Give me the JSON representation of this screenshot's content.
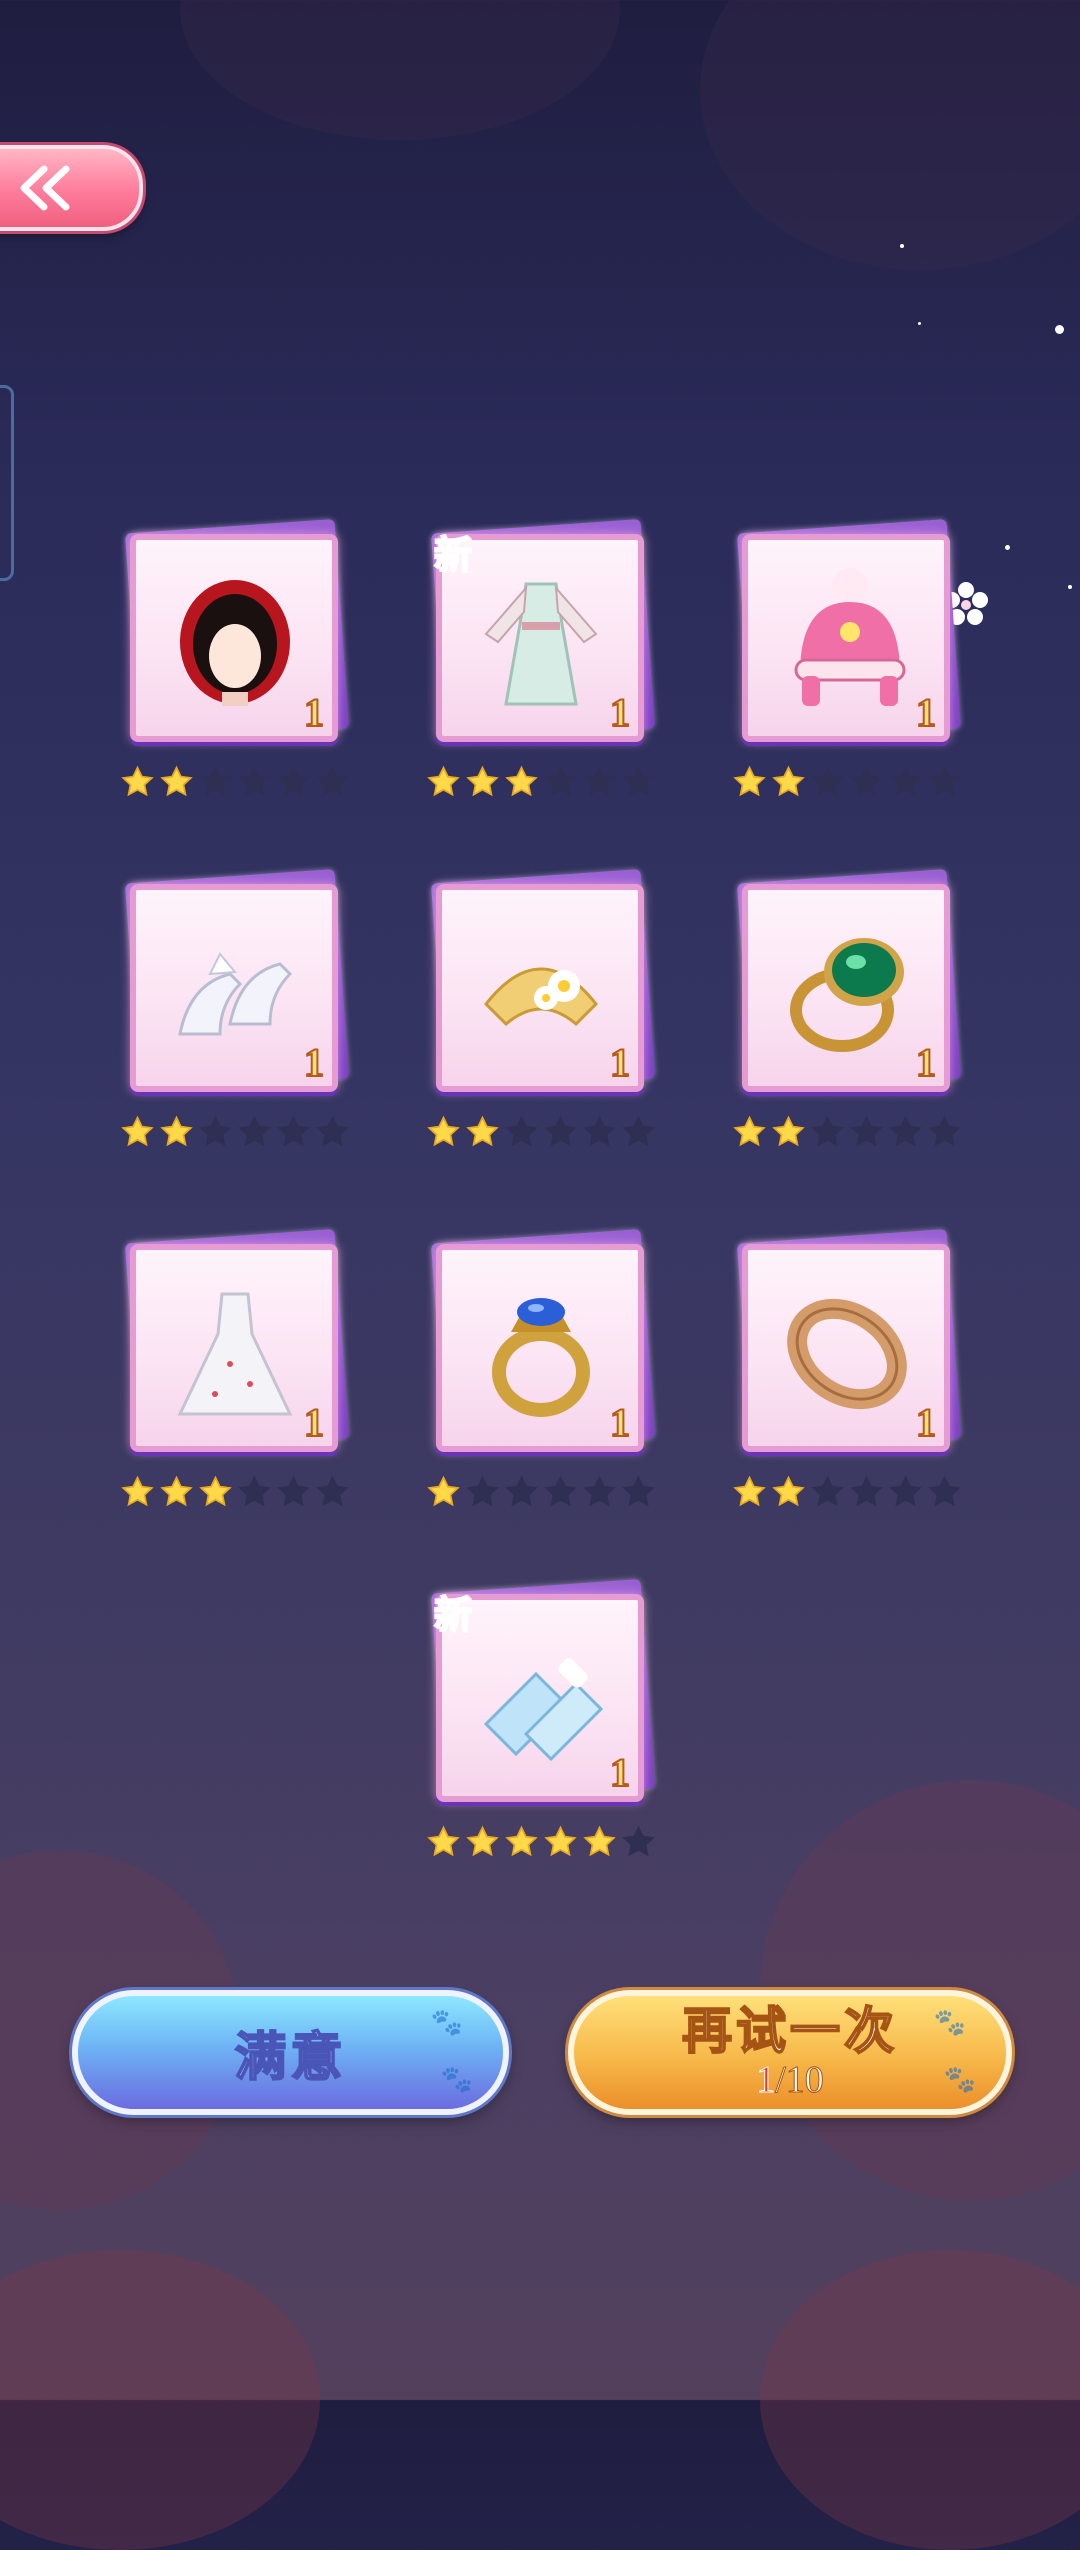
{
  "header": {
    "back_icon": "double-chevron-left-icon"
  },
  "items": [
    {
      "name": "red-hood-headwear",
      "icon": "red-hood-icon",
      "quantity": "1",
      "rarity": 2,
      "max_rarity": 6,
      "is_new": false
    },
    {
      "name": "hanfu-dress",
      "icon": "hanfu-dress-icon",
      "quantity": "1",
      "rarity": 3,
      "max_rarity": 6,
      "is_new": true
    },
    {
      "name": "pink-beanie-hat",
      "icon": "pink-hat-icon",
      "quantity": "1",
      "rarity": 2,
      "max_rarity": 6,
      "is_new": false
    },
    {
      "name": "white-heels",
      "icon": "white-heels-icon",
      "quantity": "1",
      "rarity": 2,
      "max_rarity": 6,
      "is_new": false
    },
    {
      "name": "golden-fan",
      "icon": "golden-fan-icon",
      "quantity": "1",
      "rarity": 2,
      "max_rarity": 6,
      "is_new": false
    },
    {
      "name": "emerald-ring",
      "icon": "emerald-ring-icon",
      "quantity": "1",
      "rarity": 2,
      "max_rarity": 6,
      "is_new": false
    },
    {
      "name": "wedding-gown",
      "icon": "wedding-gown-icon",
      "quantity": "1",
      "rarity": 3,
      "max_rarity": 6,
      "is_new": false
    },
    {
      "name": "sapphire-ring",
      "icon": "sapphire-ring-icon",
      "quantity": "1",
      "rarity": 1,
      "max_rarity": 6,
      "is_new": false
    },
    {
      "name": "engraved-gold-band",
      "icon": "gold-band-icon",
      "quantity": "1",
      "rarity": 2,
      "max_rarity": 6,
      "is_new": false
    },
    {
      "name": "lace-gloves",
      "icon": "lace-gloves-icon",
      "quantity": "1",
      "rarity": 5,
      "max_rarity": 6,
      "is_new": true
    }
  ],
  "new_label": "新",
  "buttons": {
    "satisfied_label": "满意",
    "retry_label": "再试一次",
    "retry_used": "1",
    "retry_total": "/10"
  },
  "colors": {
    "star_on": "#ffd94a",
    "star_off": "#2e2f52",
    "new_badge": "#ff5cc8"
  }
}
